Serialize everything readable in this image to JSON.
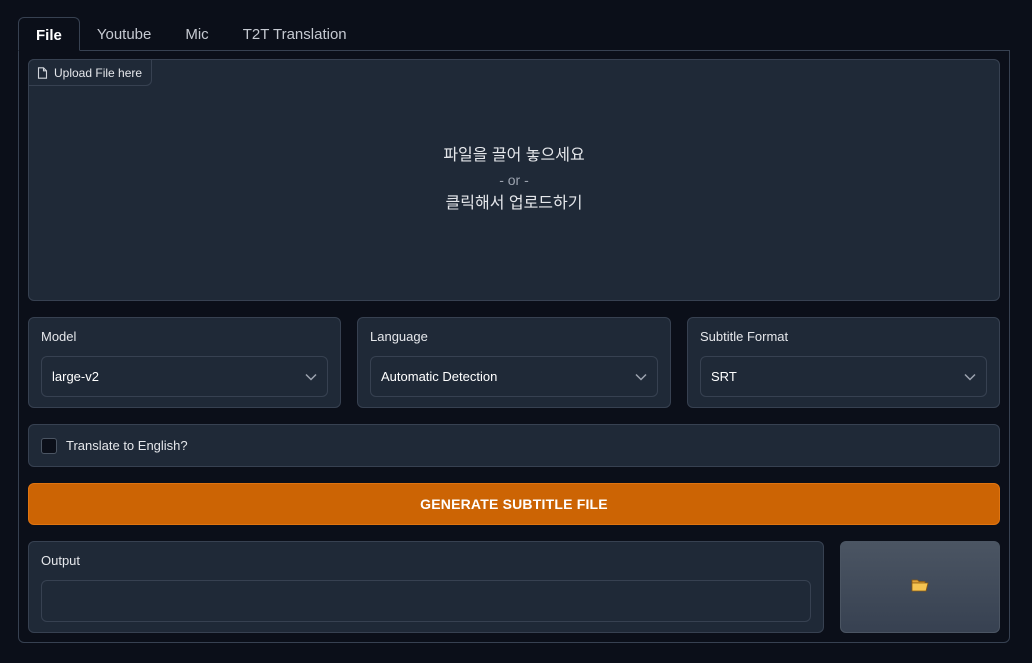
{
  "tabs": [
    {
      "label": "File",
      "active": true
    },
    {
      "label": "Youtube",
      "active": false
    },
    {
      "label": "Mic",
      "active": false
    },
    {
      "label": "T2T Translation",
      "active": false
    }
  ],
  "upload": {
    "label": "Upload File here",
    "icon": "file-icon",
    "drop_text": "파일을 끌어 놓으세요",
    "or_text": "- or -",
    "click_text": "클릭해서 업로드하기"
  },
  "model": {
    "label": "Model",
    "value": "large-v2"
  },
  "language": {
    "label": "Language",
    "value": "Automatic Detection"
  },
  "subtitle_format": {
    "label": "Subtitle Format",
    "value": "SRT"
  },
  "translate": {
    "label": "Translate to English?",
    "checked": false
  },
  "generate_button": {
    "label": "GENERATE SUBTITLE FILE"
  },
  "output": {
    "label": "Output",
    "value": ""
  },
  "open_folder_button": {
    "icon": "folder-icon"
  },
  "colors": {
    "background": "#0b0f19",
    "panel": "#1f2937",
    "border": "#374151",
    "accent": "#cc6404"
  }
}
